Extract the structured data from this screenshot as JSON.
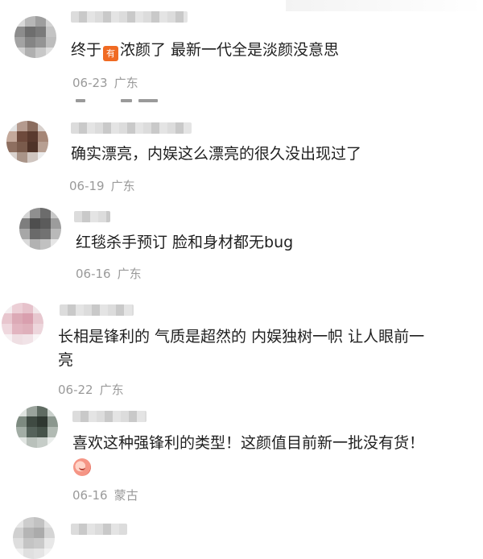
{
  "comments": [
    {
      "text_before": "终于",
      "badge": "有",
      "text_after": "浓颜了 最新一代全是淡颜没意思",
      "date": "06-23",
      "location": "广东"
    },
    {
      "text": "确实漂亮，内娱这么漂亮的很久没出现过了",
      "date": "06-19",
      "location": "广东"
    },
    {
      "text": "红毯杀手预订 脸和身材都无bug",
      "date": "06-16",
      "location": "广东"
    },
    {
      "text": "长相是锋利的 气质是超然的 内娱独树一帜 让人眼前一\n亮",
      "date": "06-22",
      "location": "广东"
    },
    {
      "text": "喜欢这种强锋利的类型！这颜值目前新一批没有货！",
      "emoji": "peach-face-emoji",
      "date": "06-16",
      "location": "蒙古"
    }
  ]
}
